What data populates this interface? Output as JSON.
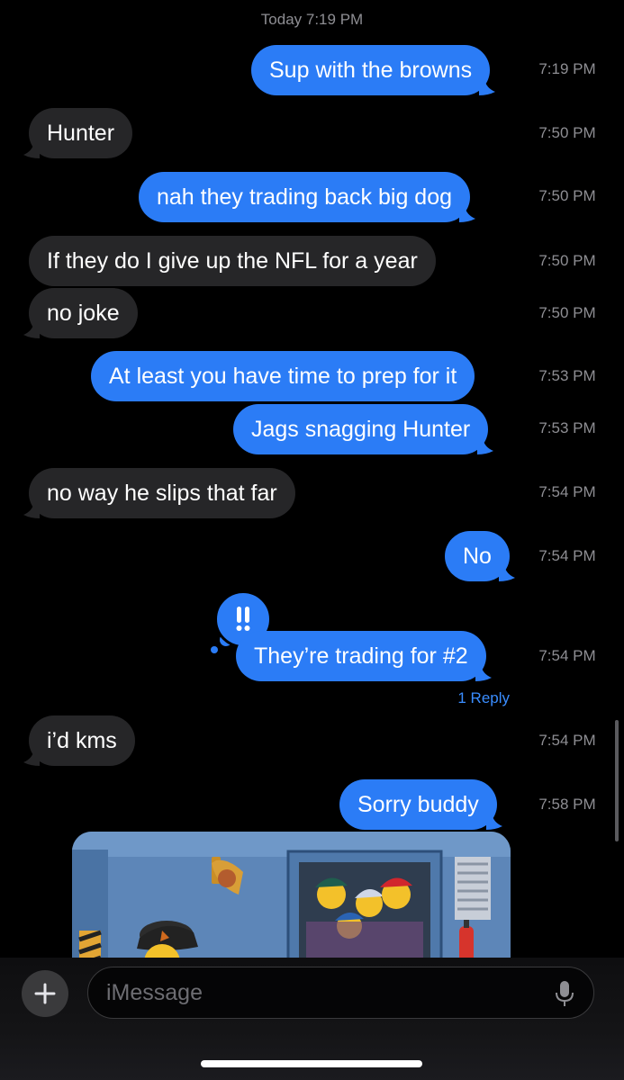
{
  "header": {
    "date_label": "Today 7:19 PM"
  },
  "messages": [
    {
      "text": "Sup with the browns",
      "time": "7:19 PM",
      "from": "me"
    },
    {
      "text": "Hunter",
      "time": "7:50 PM",
      "from": "them"
    },
    {
      "text": "nah they trading back big dog",
      "time": "7:50 PM",
      "from": "me"
    },
    {
      "text": "If they do I give up the NFL for a year",
      "time": "7:50 PM",
      "from": "them"
    },
    {
      "text": "no joke",
      "time": "7:50 PM",
      "from": "them"
    },
    {
      "text": "At least you have time to prep for it",
      "time": "7:53 PM",
      "from": "me"
    },
    {
      "text": "Jags snagging Hunter",
      "time": "7:53 PM",
      "from": "me"
    },
    {
      "text": "no way he slips that far",
      "time": "7:54 PM",
      "from": "them"
    },
    {
      "text": "No",
      "time": "7:54 PM",
      "from": "me"
    },
    {
      "text": "They’re trading for #2",
      "time": "7:54 PM",
      "from": "me",
      "tapback": "!!",
      "reply_label": "1 Reply"
    },
    {
      "text": "i’d kms",
      "time": "7:54 PM",
      "from": "them"
    },
    {
      "text": "Sorry buddy",
      "time": "7:58 PM",
      "from": "me"
    }
  ],
  "composer": {
    "placeholder": "iMessage",
    "plus_icon": "plus-icon",
    "mic_icon": "mic-icon"
  },
  "colors": {
    "outgoing": "#2b7cf6",
    "incoming": "#262628",
    "background": "#000000",
    "time_text": "#8e8e93"
  }
}
